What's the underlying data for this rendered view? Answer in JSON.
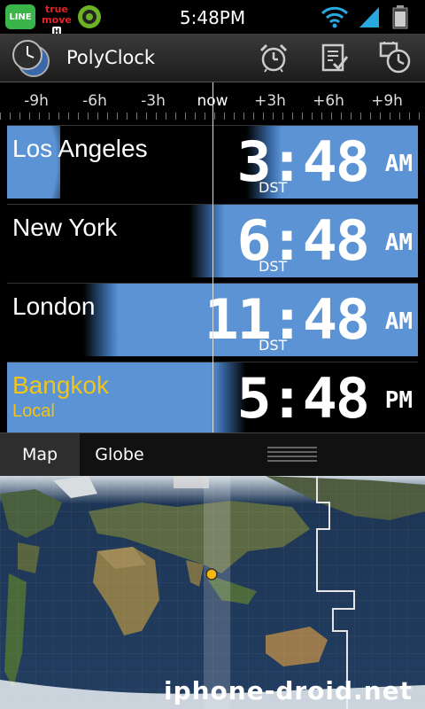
{
  "status_bar": {
    "time": "5:48PM",
    "icons": [
      "line-app-icon",
      "truemove-h-icon",
      "green-app-icon",
      "wifi-icon",
      "signal-icon",
      "battery-icon"
    ],
    "line_label": "LINE",
    "carrier_top": "true",
    "carrier_mid": "move",
    "carrier_badge": "H"
  },
  "app_bar": {
    "title": "PolyClock",
    "actions": [
      "alarm-clock-icon",
      "task-list-icon",
      "timer-icon"
    ]
  },
  "timeline": {
    "labels": [
      "-9h",
      "-6h",
      "-3h",
      "now",
      "+3h",
      "+6h",
      "+9h"
    ]
  },
  "cities": [
    {
      "name": "Los Angeles",
      "time": "3:48",
      "ampm": "AM",
      "dst": "DST",
      "local": ""
    },
    {
      "name": "New York",
      "time": "6:48",
      "ampm": "AM",
      "dst": "DST",
      "local": ""
    },
    {
      "name": "London",
      "time": "11:48",
      "ampm": "AM",
      "dst": "DST",
      "local": ""
    },
    {
      "name": "Bangkok",
      "time": "5:48",
      "ampm": "PM",
      "dst": "",
      "local": "Local"
    }
  ],
  "tabs": {
    "map": "Map",
    "globe": "Globe",
    "selected": "Map"
  },
  "map": {
    "watermark": "iphone-droid.net",
    "marker_color": "#f5b80f"
  },
  "colors": {
    "day_blue": "#5b93d4",
    "local_yellow": "#f0c419",
    "background": "#000000"
  }
}
